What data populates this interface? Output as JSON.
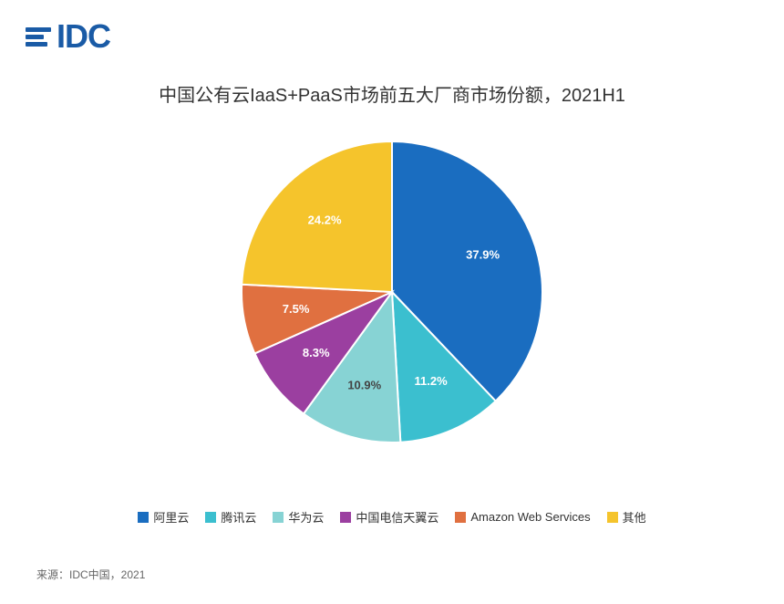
{
  "logo": {
    "text": "IDC",
    "color": "#1a5ba6"
  },
  "title": "中国公有云IaaS+PaaS市场前五大厂商市场份额，2021H1",
  "chart": {
    "segments": [
      {
        "name": "阿里云",
        "value": 37.9,
        "color": "#1a6dc0",
        "label": "37.9%",
        "midAngle": -54
      },
      {
        "name": "腾讯云",
        "value": 11.2,
        "color": "#3bbfcf",
        "label": "11.2%",
        "midAngle": 55
      },
      {
        "name": "华为云",
        "value": 10.9,
        "color": "#87d3d4",
        "label": "10.9%",
        "midAngle": 96
      },
      {
        "name": "中国电信天翼云",
        "value": 8.3,
        "color": "#9b3fa0",
        "label": "8.3%",
        "midAngle": 131
      },
      {
        "name": "Amazon Web Services",
        "value": 7.5,
        "color": "#e07040",
        "label": "7.5%",
        "midAngle": 157
      },
      {
        "name": "其他",
        "value": 24.2,
        "color": "#f5c42c",
        "label": "24.2%",
        "midAngle": -148
      }
    ]
  },
  "legend": [
    {
      "label": "阿里云",
      "color": "#1a6dc0"
    },
    {
      "label": "腾讯云",
      "color": "#3bbfcf"
    },
    {
      "label": "华为云",
      "color": "#87d3d4"
    },
    {
      "label": "中国电信天翼云",
      "color": "#9b3fa0"
    },
    {
      "label": "Amazon Web Services",
      "color": "#e07040"
    },
    {
      "label": "其他",
      "color": "#f5c42c"
    }
  ],
  "source": "来源：IDC中国，2021"
}
